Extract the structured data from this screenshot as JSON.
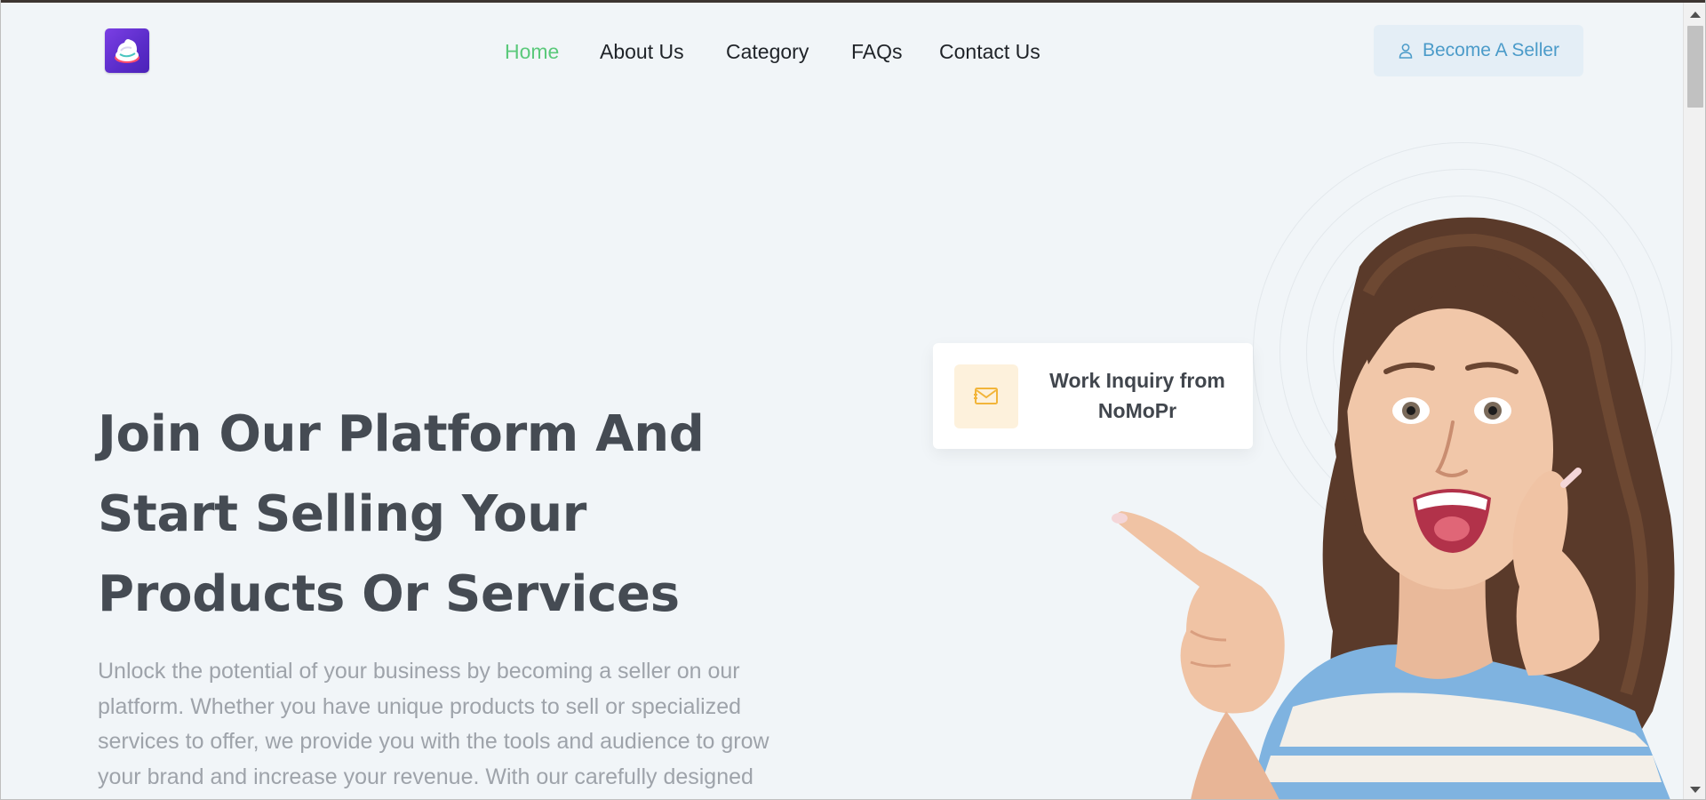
{
  "header": {
    "logo_icon": "cake-logo-icon",
    "nav": [
      {
        "label": "Home",
        "active": true
      },
      {
        "label": "About Us",
        "active": false
      },
      {
        "label": "Category",
        "active": false
      },
      {
        "label": "FAQs",
        "active": false
      },
      {
        "label": "Contact Us",
        "active": false
      }
    ],
    "cta": {
      "label": "Become A Seller",
      "icon": "user-icon"
    }
  },
  "hero": {
    "title": "Join Our Platform And Start Selling Your Products Or Services",
    "description": "Unlock the potential of your business by becoming a seller on our platform. Whether you have unique products to sell or specialized services to offer, we provide you with the tools and audience to grow your brand and increase your revenue. With our carefully designed"
  },
  "inquiry_card": {
    "icon": "envelope-icon",
    "text": "Work Inquiry from NoMoPr"
  },
  "colors": {
    "background": "#f1f5f8",
    "nav_active": "#5bc97b",
    "cta_background": "#e4eef6",
    "cta_text": "#4b9bc9",
    "title": "#454b53",
    "body_text": "#9ea3aa",
    "card_icon_bg": "#fdf1dc",
    "card_icon": "#f2b53a"
  }
}
